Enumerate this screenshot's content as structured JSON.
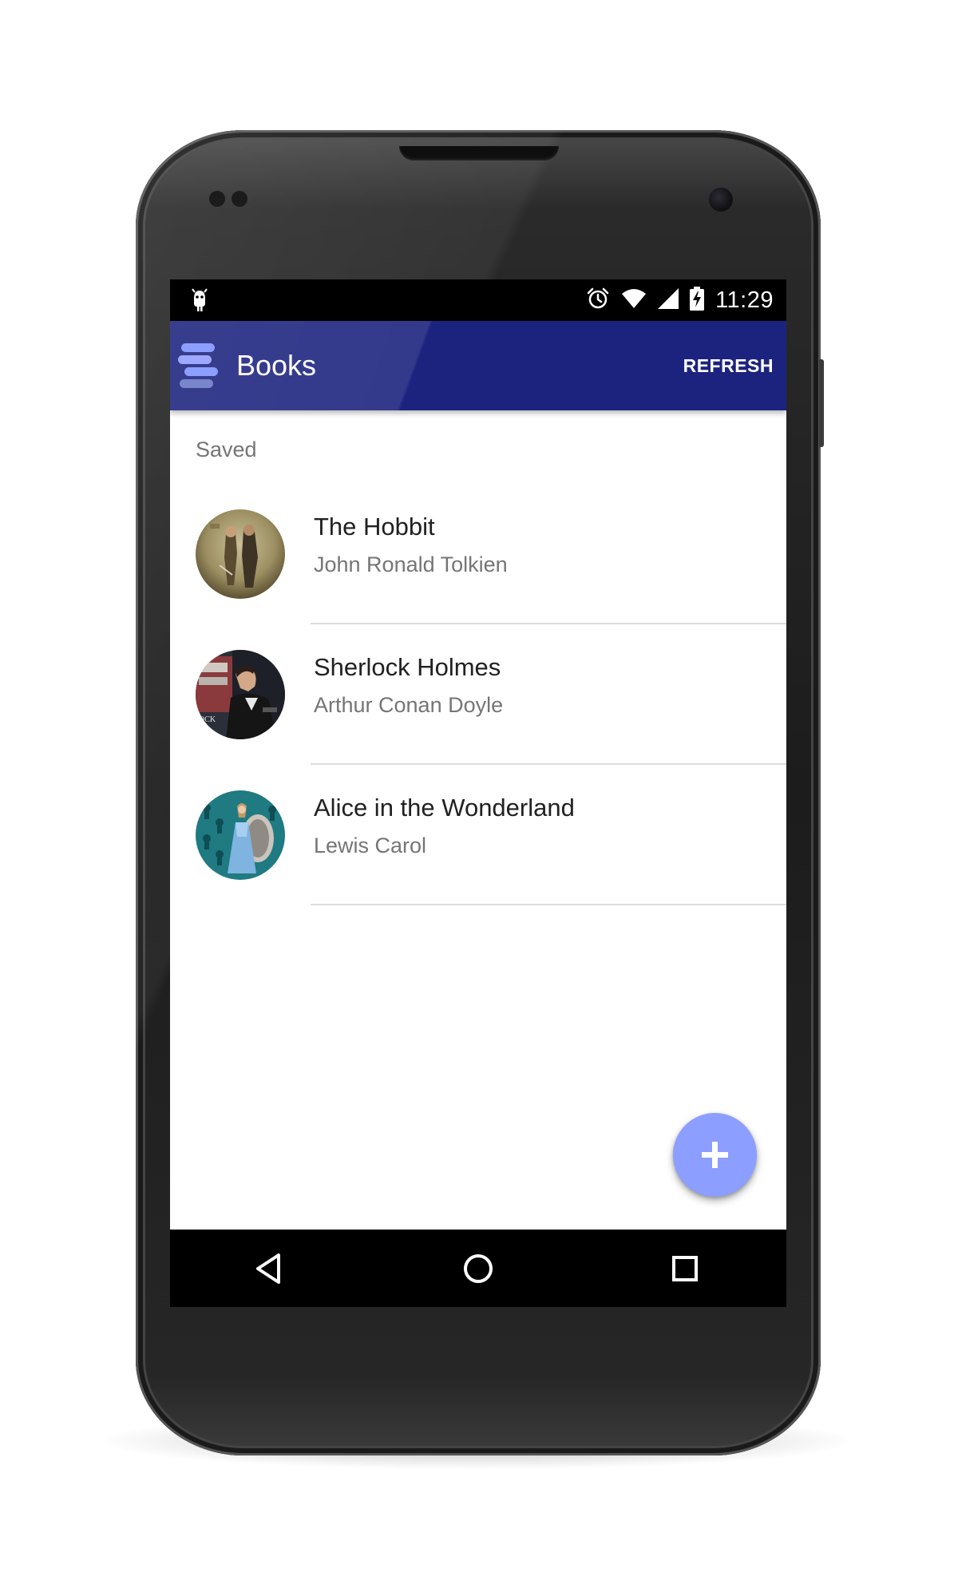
{
  "status_bar": {
    "time": "11:29",
    "icons": [
      "android-debug-icon",
      "alarm-icon",
      "wifi-icon",
      "signal-icon",
      "battery-charging-icon"
    ]
  },
  "app_bar": {
    "title": "Books",
    "action_label": "REFRESH",
    "logo_icon": "books-logo-icon",
    "color": "#1c237e"
  },
  "section": {
    "header": "Saved"
  },
  "books": [
    {
      "title": "The Hobbit",
      "author": "John Ronald Tolkien",
      "cover_icon": "hobbit-cover-image"
    },
    {
      "title": "Sherlock Holmes",
      "author": "Arthur Conan Doyle",
      "cover_icon": "sherlock-cover-image"
    },
    {
      "title": "Alice in the Wonderland",
      "author": "Lewis Carol",
      "cover_icon": "alice-cover-image"
    }
  ],
  "fab": {
    "icon": "plus-icon",
    "color": "#8c9eff"
  },
  "nav_bar": {
    "buttons": [
      "back-icon",
      "home-icon",
      "recents-icon"
    ]
  }
}
